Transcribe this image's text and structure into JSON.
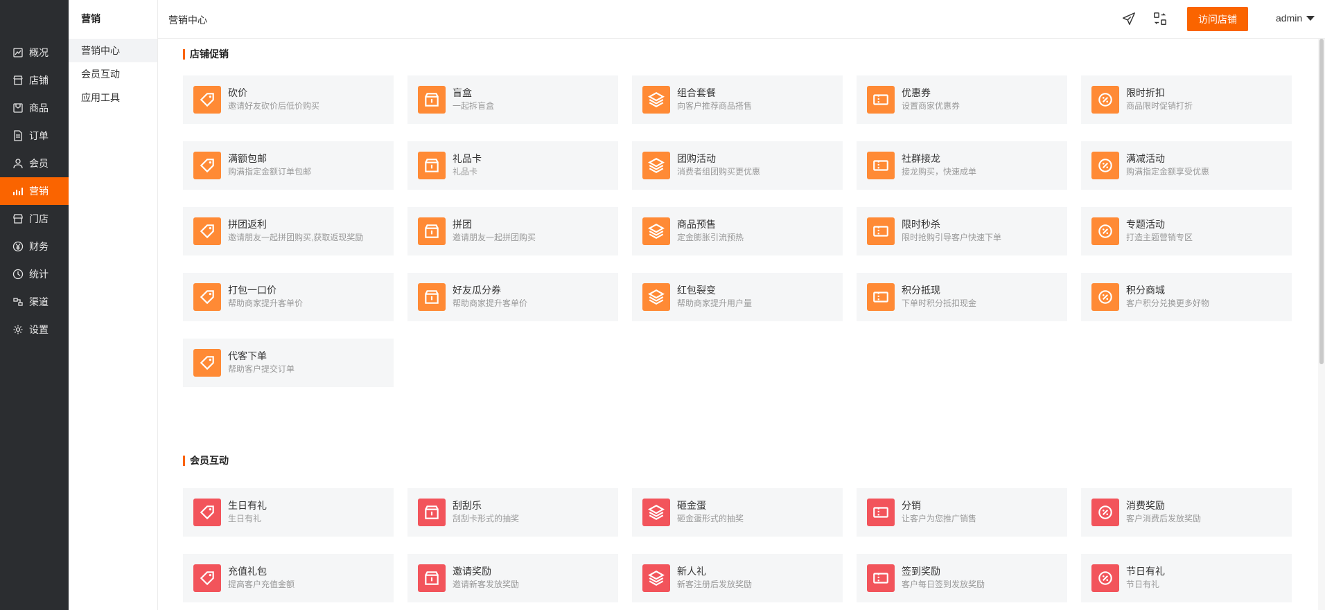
{
  "sidebar": {
    "items": [
      {
        "label": "概况",
        "icon": "chart-line-icon"
      },
      {
        "label": "店铺",
        "icon": "store-icon"
      },
      {
        "label": "商品",
        "icon": "box-icon"
      },
      {
        "label": "订单",
        "icon": "document-icon"
      },
      {
        "label": "会员",
        "icon": "user-icon"
      },
      {
        "label": "营销",
        "icon": "bar-chart-icon",
        "active": true
      },
      {
        "label": "门店",
        "icon": "shop-icon"
      },
      {
        "label": "财务",
        "icon": "yen-icon"
      },
      {
        "label": "统计",
        "icon": "clock-icon"
      },
      {
        "label": "渠道",
        "icon": "channel-icon"
      },
      {
        "label": "设置",
        "icon": "gear-icon"
      }
    ]
  },
  "submenu": {
    "title": "营销",
    "items": [
      "营销中心",
      "会员互动",
      "应用工具"
    ]
  },
  "header": {
    "breadcrumb": "营销中心",
    "visit_button": "访问店铺",
    "user": "admin"
  },
  "colors": {
    "accent": "#fa6400",
    "promo_icon_bg": "#ff8a35",
    "member_icon_bg": "#f2545b"
  },
  "sections": [
    {
      "title": "店铺促销",
      "cards": [
        {
          "name": "砍价",
          "desc": "邀请好友砍价后低价购买"
        },
        {
          "name": "盲盒",
          "desc": "一起拆盲盒"
        },
        {
          "name": "组合套餐",
          "desc": "向客户推荐商品搭售"
        },
        {
          "name": "优惠券",
          "desc": "设置商家优惠券"
        },
        {
          "name": "限时折扣",
          "desc": "商品限时促销打折"
        },
        {
          "name": "满额包邮",
          "desc": "购满指定金额订单包邮"
        },
        {
          "name": "礼品卡",
          "desc": "礼品卡"
        },
        {
          "name": "团购活动",
          "desc": "消费者组团购买更优惠"
        },
        {
          "name": "社群接龙",
          "desc": "接龙购买，快速成单"
        },
        {
          "name": "满减活动",
          "desc": "购满指定金额享受优惠"
        },
        {
          "name": "拼团返利",
          "desc": "邀请朋友一起拼团购买,获取返现奖励"
        },
        {
          "name": "拼团",
          "desc": "邀请朋友一起拼团购买"
        },
        {
          "name": "商品预售",
          "desc": "定金膨胀引流预热"
        },
        {
          "name": "限时秒杀",
          "desc": "限时抢购引导客户快速下单"
        },
        {
          "name": "专题活动",
          "desc": "打造主题营销专区"
        },
        {
          "name": "打包一口价",
          "desc": "帮助商家提升客单价"
        },
        {
          "name": "好友瓜分券",
          "desc": "帮助商家提升客单价"
        },
        {
          "name": "红包裂变",
          "desc": "帮助商家提升用户量"
        },
        {
          "name": "积分抵现",
          "desc": "下单时积分抵扣现金"
        },
        {
          "name": "积分商城",
          "desc": "客户积分兑换更多好物"
        },
        {
          "name": "代客下单",
          "desc": "帮助客户提交订单"
        }
      ]
    },
    {
      "title": "会员互动",
      "cards": [
        {
          "name": "生日有礼",
          "desc": "生日有礼"
        },
        {
          "name": "刮刮乐",
          "desc": "刮刮卡形式的抽奖"
        },
        {
          "name": "砸金蛋",
          "desc": "砸金蛋形式的抽奖"
        },
        {
          "name": "分销",
          "desc": "让客户为您推广销售"
        },
        {
          "name": "消费奖励",
          "desc": "客户消费后发放奖励"
        },
        {
          "name": "充值礼包",
          "desc": "提高客户充值金额"
        },
        {
          "name": "邀请奖励",
          "desc": "邀请新客发放奖励"
        },
        {
          "name": "新人礼",
          "desc": "新客注册后发放奖励"
        },
        {
          "name": "签到奖励",
          "desc": "客户每日签到发放奖励"
        },
        {
          "name": "节日有礼",
          "desc": "节日有礼"
        }
      ]
    }
  ]
}
